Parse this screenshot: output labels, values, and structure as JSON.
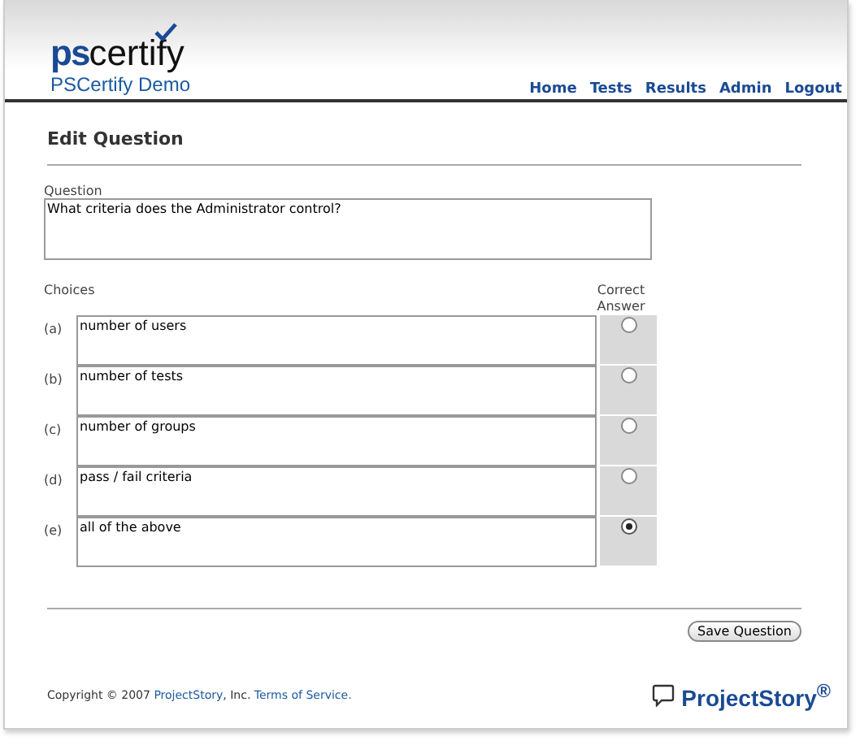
{
  "logo": {
    "bold_part": "ps",
    "rest": "certify"
  },
  "site_title": "PSCertify Demo",
  "nav": [
    "Home",
    "Tests",
    "Results",
    "Admin",
    "Logout"
  ],
  "heading": "Edit Question",
  "question": {
    "label": "Question",
    "value": "What criteria does the Administrator control?"
  },
  "choices_label": "Choices",
  "correct_label": "Correct Answer",
  "choices": [
    {
      "letter": "(a)",
      "value": "number of users",
      "selected": false
    },
    {
      "letter": "(b)",
      "value": "number of tests",
      "selected": false
    },
    {
      "letter": "(c)",
      "value": "number of groups",
      "selected": false
    },
    {
      "letter": "(d)",
      "value": "pass / fail criteria",
      "selected": false
    },
    {
      "letter": "(e)",
      "value": "all of the above",
      "selected": true
    }
  ],
  "save_button": "Save Question",
  "footer": {
    "text_before": "Copyright © 2007",
    "company_link": "ProjectStory",
    "text_after": ", Inc.",
    "terms_link": "Terms of Service."
  },
  "brand": "ProjectStory$^{®}$"
}
